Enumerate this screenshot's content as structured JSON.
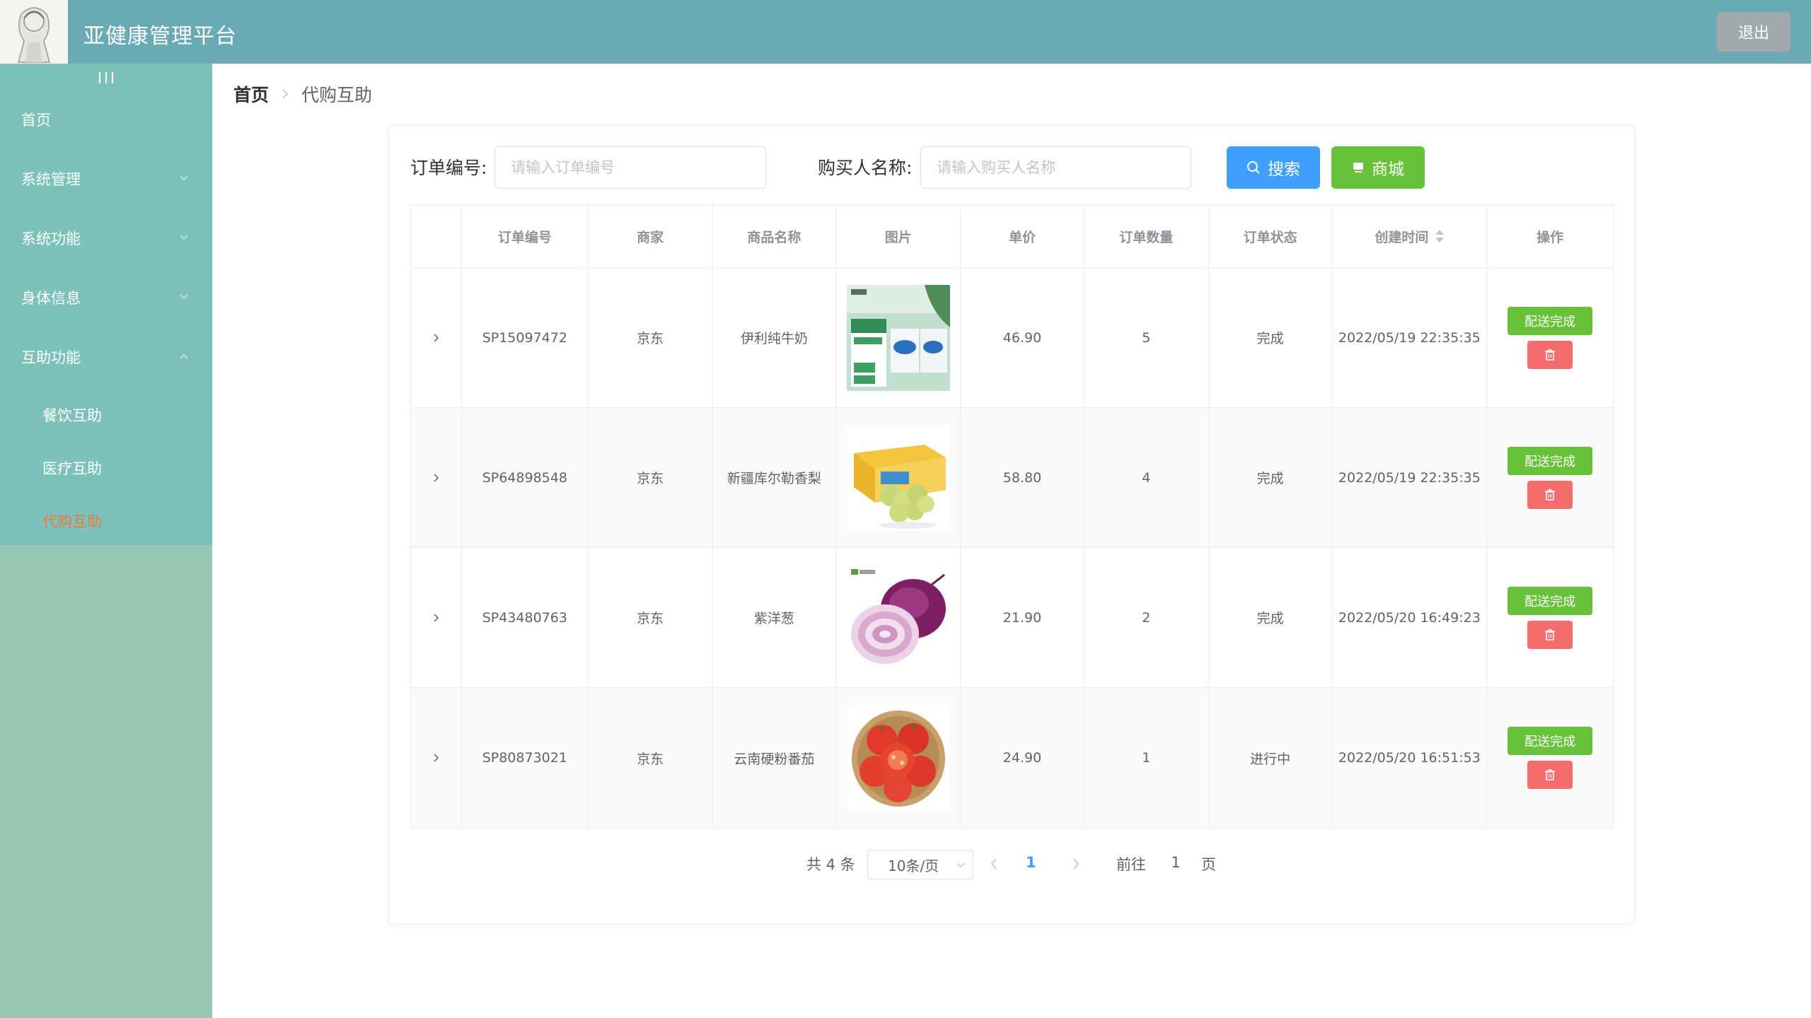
{
  "app": {
    "title": "亚健康管理平台",
    "logout_label": "退出"
  },
  "sidebar": {
    "items": [
      {
        "label": "首页",
        "has_children": false
      },
      {
        "label": "系统管理",
        "has_children": true,
        "expanded": false
      },
      {
        "label": "系统功能",
        "has_children": true,
        "expanded": false
      },
      {
        "label": "身体信息",
        "has_children": true,
        "expanded": false
      },
      {
        "label": "互助功能",
        "has_children": true,
        "expanded": true
      }
    ],
    "sub_items": [
      {
        "label": "餐饮互助",
        "active": false
      },
      {
        "label": "医疗互助",
        "active": false
      },
      {
        "label": "代购互助",
        "active": true
      }
    ]
  },
  "breadcrumb": {
    "home": "首页",
    "current": "代购互助"
  },
  "search": {
    "order_no_label": "订单编号:",
    "order_no_placeholder": "请输入订单编号",
    "buyer_label": "购买人名称:",
    "buyer_placeholder": "请输入购买人名称",
    "search_button": "搜索",
    "mall_button": "商城"
  },
  "table": {
    "columns": [
      "订单编号",
      "商家",
      "商品名称",
      "图片",
      "单价",
      "订单数量",
      "订单状态",
      "创建时间",
      "操作"
    ],
    "deliver_label": "配送完成",
    "rows": [
      {
        "order_no": "SP15097472",
        "merchant": "京东",
        "product": "伊利纯牛奶",
        "image": "milk-box",
        "price": "46.90",
        "quantity": "5",
        "status": "完成",
        "created": "2022/05/19 22:35:35"
      },
      {
        "order_no": "SP64898548",
        "merchant": "京东",
        "product": "新疆库尔勒香梨",
        "image": "pears-box",
        "price": "58.80",
        "quantity": "4",
        "status": "完成",
        "created": "2022/05/19 22:35:35"
      },
      {
        "order_no": "SP43480763",
        "merchant": "京东",
        "product": "紫洋葱",
        "image": "red-onion",
        "price": "21.90",
        "quantity": "2",
        "status": "完成",
        "created": "2022/05/20 16:49:23"
      },
      {
        "order_no": "SP80873021",
        "merchant": "京东",
        "product": "云南硬粉番茄",
        "image": "tomatoes-basket",
        "price": "24.90",
        "quantity": "1",
        "status": "进行中",
        "created": "2022/05/20 16:51:53"
      }
    ]
  },
  "pagination": {
    "total_text": "共 4 条",
    "page_size": "10条/页",
    "current_page": "1",
    "goto_prefix": "前往",
    "goto_value": "1",
    "goto_suffix": "页"
  },
  "colors": {
    "header": "#69aab4",
    "sidebar": "#7cc2ba",
    "sidebar_lower": "#98c8b4",
    "active_menu": "#e8793d",
    "primary": "#409eff",
    "success": "#67c23a",
    "danger": "#f56c6c",
    "logout": "#a1a9ad"
  }
}
